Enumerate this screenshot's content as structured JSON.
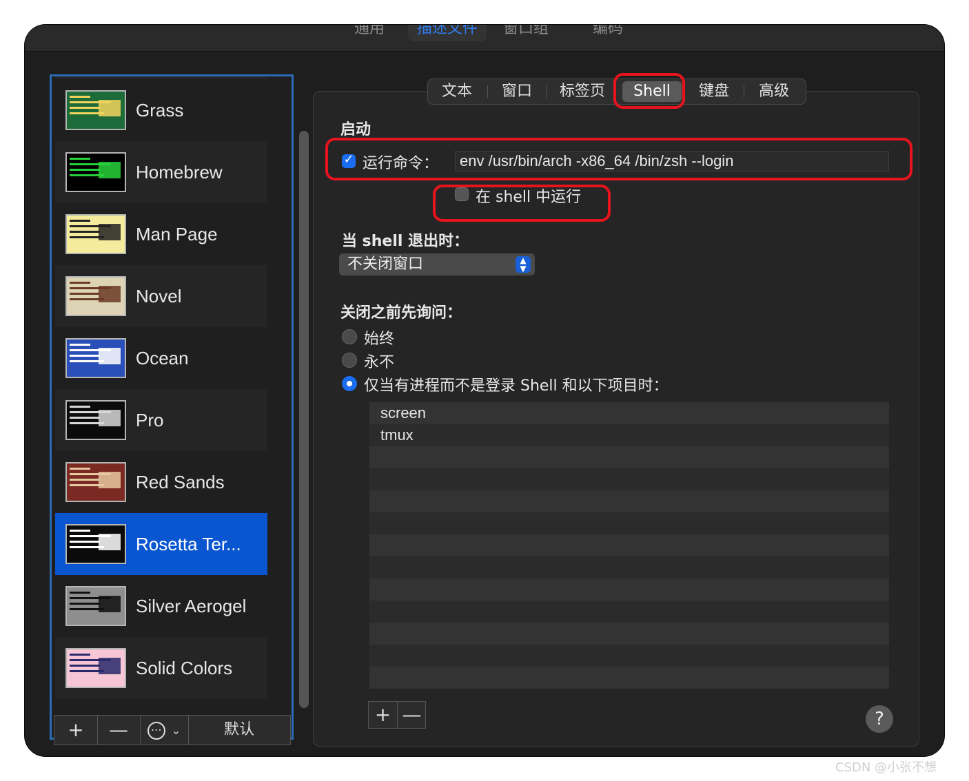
{
  "top_tabs": [
    {
      "label": "通用"
    },
    {
      "label": "描述文件"
    },
    {
      "label": "窗口组"
    },
    {
      "label": "编码"
    }
  ],
  "profiles": [
    {
      "name": "Grass",
      "bg": "#1e6b3a",
      "fg": "#f2d45c"
    },
    {
      "name": "Homebrew",
      "bg": "#000000",
      "fg": "#28d13a"
    },
    {
      "name": "Man Page",
      "bg": "#f4ec9c",
      "fg": "#222222"
    },
    {
      "name": "Novel",
      "bg": "#dcd4b4",
      "fg": "#6b3a24"
    },
    {
      "name": "Ocean",
      "bg": "#2a4fb8",
      "fg": "#ffffff"
    },
    {
      "name": "Pro",
      "bg": "#0b0b0b",
      "fg": "#d8d8d8"
    },
    {
      "name": "Red Sands",
      "bg": "#7a2a22",
      "fg": "#e6c8a0"
    },
    {
      "name": "Rosetta Ter...",
      "bg": "#0b0b0b",
      "fg": "#ffffff"
    },
    {
      "name": "Silver Aerogel",
      "bg": "#8e8e8e",
      "fg": "#111111"
    },
    {
      "name": "Solid Colors",
      "bg": "#f6c6d6",
      "fg": "#2a2a6a"
    }
  ],
  "list_toolbar": {
    "add": "+",
    "remove": "—",
    "more": "⋯",
    "more_caret": "⌄",
    "default": "默认"
  },
  "settings_tabs": [
    {
      "label": "文本"
    },
    {
      "label": "窗口"
    },
    {
      "label": "标签页"
    },
    {
      "label": "Shell"
    },
    {
      "label": "键盘"
    },
    {
      "label": "高级"
    }
  ],
  "startup": {
    "heading": "启动",
    "run_command_label": "运行命令：",
    "run_command_checked": true,
    "command_value": "env /usr/bin/arch -x86_64 /bin/zsh --login",
    "run_in_shell_label": "在 shell 中运行",
    "run_in_shell_checked": false
  },
  "on_exit": {
    "heading": "当 shell 退出时：",
    "selected": "不关闭窗口"
  },
  "ask_before_close": {
    "heading": "关闭之前先询问：",
    "options": [
      {
        "label": "始终",
        "selected": false
      },
      {
        "label": "永不",
        "selected": false
      },
      {
        "label": "仅当有进程而不是登录 Shell 和以下项目时：",
        "selected": true
      }
    ],
    "processes": [
      "screen",
      "tmux"
    ]
  },
  "process_buttons": {
    "add": "+",
    "remove": "—"
  },
  "help": "?",
  "watermark": "CSDN @小张不想"
}
